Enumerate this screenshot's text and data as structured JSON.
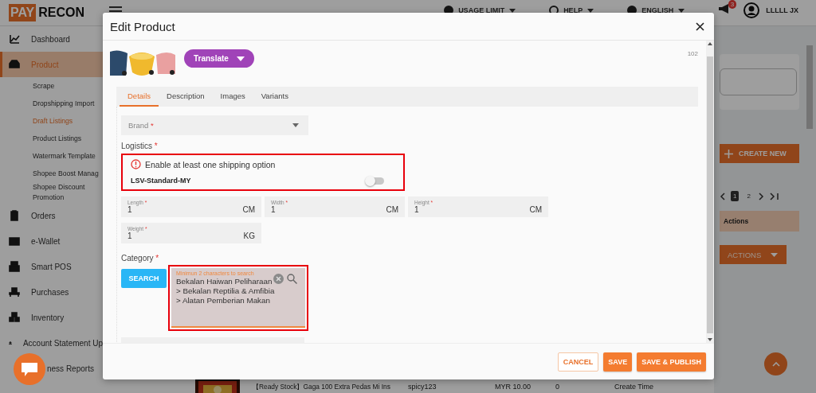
{
  "header": {
    "logo": [
      "PAY",
      "RECON"
    ],
    "menus": [
      {
        "label": "USAGE LIMIT"
      },
      {
        "label": "HELP"
      },
      {
        "label": "ENGLISH"
      }
    ],
    "notification_count": "3",
    "user_name": "LLLLL JX"
  },
  "sidebar": {
    "items": [
      {
        "label": "Dashboard",
        "selected": false
      },
      {
        "label": "Product",
        "selected": true,
        "children": [
          {
            "label": "Scrape",
            "selected": false
          },
          {
            "label": "Dropshipping Import",
            "selected": false
          },
          {
            "label": "Draft Listings",
            "selected": true
          },
          {
            "label": "Product Listings",
            "selected": false
          },
          {
            "label": "Watermark Template",
            "selected": false
          },
          {
            "label": "Shopee Boost Manag",
            "selected": false
          },
          {
            "label": "Shopee Discount Promotion",
            "selected": false
          }
        ]
      },
      {
        "label": "Orders",
        "selected": false
      },
      {
        "label": "e-Wallet",
        "selected": false
      },
      {
        "label": "Smart POS",
        "selected": false
      },
      {
        "label": "Purchases",
        "selected": false
      },
      {
        "label": "Inventory",
        "selected": false
      },
      {
        "label": "Account Statement Up",
        "selected": false
      },
      {
        "label": "ness Reports",
        "selected": false
      }
    ]
  },
  "page": {
    "create_button": "CREATE NEW",
    "pagination": [
      {
        "label": "1",
        "selected": true
      },
      {
        "label": "2",
        "selected": false
      }
    ],
    "actions_header": "Actions",
    "actions_button": "ACTIONS",
    "table_row": {
      "product": "【Ready Stock】Gaga 100 Extra Pedas Mi Ins",
      "sku": "spicy123",
      "price": "MYR 10.00",
      "stock": "0",
      "date_label": "Create Time"
    }
  },
  "modal": {
    "title": "Edit Product",
    "translate_button": "Translate",
    "char_count": "102",
    "tabs": [
      {
        "label": "Details",
        "selected": true
      },
      {
        "label": "Description",
        "selected": false
      },
      {
        "label": "Images",
        "selected": false
      },
      {
        "label": "Variants",
        "selected": false
      }
    ],
    "brand": {
      "label": "Brand",
      "required_mark": "*"
    },
    "logistics": {
      "label": "Logistics",
      "required_mark": "*",
      "error": "Enable at least one shipping option",
      "options": [
        {
          "name": "LSV-Standard-MY",
          "on": false
        }
      ]
    },
    "dimension_rows": [
      {
        "fields": [
          {
            "label": "Length",
            "required_mark": "*",
            "value": "1",
            "unit": "CM"
          },
          {
            "label": "Width",
            "required_mark": "*",
            "value": "1",
            "unit": "CM"
          },
          {
            "label": "Height",
            "required_mark": "*",
            "value": "1",
            "unit": "CM"
          }
        ]
      },
      {
        "fields": [
          {
            "label": "Weight",
            "required_mark": "*",
            "value": "1",
            "unit": "KG"
          }
        ]
      }
    ],
    "category": {
      "label": "Category",
      "required_mark": "*",
      "search_button": "SEARCH",
      "field": {
        "placeholder": "Minimun 2 characters to search",
        "value": "Bekalan Haiwan Peliharaan > Bekalan Reptilia & Amfibia > Alatan Pemberian Makan"
      }
    },
    "buttons": [
      {
        "label": "CANCEL",
        "kind": "outline"
      },
      {
        "label": "SAVE",
        "kind": "filled"
      },
      {
        "label": "SAVE & PUBLISH",
        "kind": "filled"
      }
    ]
  }
}
